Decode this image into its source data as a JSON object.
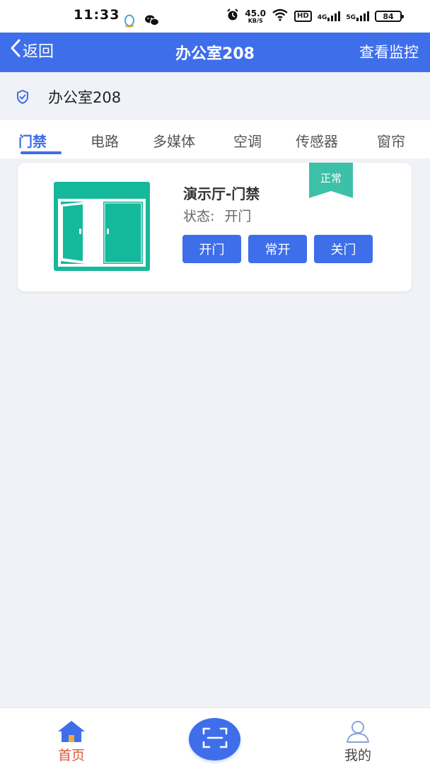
{
  "status_bar": {
    "time": "11:33",
    "net_speed": "45.0",
    "net_speed_unit": "KB/S",
    "hd_label": "HD",
    "net_4g": "4G",
    "net_5g": "5G",
    "battery": "84",
    "icons": [
      "qq-icon",
      "wechat-icon",
      "alarm-icon",
      "wifi-icon"
    ]
  },
  "nav": {
    "back_label": "返回",
    "title": "办公室208",
    "right_label": "查看监控"
  },
  "room": {
    "name": "办公室208"
  },
  "tabs": [
    {
      "label": "门禁",
      "active": true
    },
    {
      "label": "电路",
      "active": false
    },
    {
      "label": "多媒体",
      "active": false
    },
    {
      "label": "空调",
      "active": false
    },
    {
      "label": "传感器",
      "active": false
    },
    {
      "label": "窗帘",
      "active": false
    }
  ],
  "device": {
    "title": "演示厅-门禁",
    "status_label": "状态:",
    "status_value": "开门",
    "badge": "正常",
    "buttons": {
      "open": "开门",
      "keep_open": "常开",
      "close": "关门"
    }
  },
  "bottom_nav": {
    "home_label": "首页",
    "mine_label": "我的"
  },
  "colors": {
    "primary": "#3e6ee9",
    "door_teal": "#16b89b",
    "badge_teal": "#3dc0a8",
    "home_active": "#e0533b"
  }
}
